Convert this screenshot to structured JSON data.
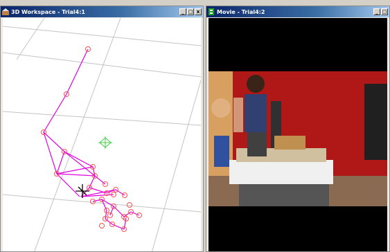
{
  "windows": {
    "workspace": {
      "title": "3D Workspace - Trial4:1",
      "controls": [
        "_",
        "□",
        "x"
      ]
    },
    "movie": {
      "title": "Movie - Trial4:2",
      "controls": [
        "_",
        "□"
      ]
    }
  },
  "colors": {
    "titlebar_start": "#0a246a",
    "titlebar_end": "#a6caf0",
    "skeleton": "#e000e0",
    "markers": "#ff6060",
    "center_marker": "#40d040",
    "grid": "#c0c0c0"
  },
  "icons": {
    "workspace_title": "workspace-app-icon",
    "movie_title": "movie-app-icon",
    "cursor": "crosshair-cursor-icon",
    "center": "green-diamond-marker-icon"
  }
}
